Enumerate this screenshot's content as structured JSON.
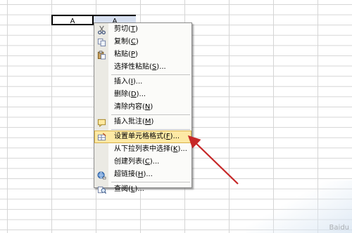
{
  "sheet": {
    "cell_a": "A",
    "cell_b": "A"
  },
  "context_menu": {
    "items": [
      {
        "label": "剪切",
        "key": "T",
        "suffix": "",
        "icon": "scissors-icon"
      },
      {
        "label": "复制",
        "key": "C",
        "suffix": "",
        "icon": "copy-icon"
      },
      {
        "label": "粘贴",
        "key": "P",
        "suffix": "",
        "icon": "paste-icon"
      },
      {
        "label": "选择性粘贴",
        "key": "S",
        "suffix": "...",
        "icon": ""
      },
      {
        "label": "插入",
        "key": "I",
        "suffix": "...",
        "icon": ""
      },
      {
        "label": "删除",
        "key": "D",
        "suffix": "...",
        "icon": ""
      },
      {
        "label": "清除内容",
        "key": "N",
        "suffix": "",
        "icon": ""
      },
      {
        "label": "插入批注",
        "key": "M",
        "suffix": "",
        "icon": "comment-icon"
      },
      {
        "label": "设置单元格格式",
        "key": "F",
        "suffix": "...",
        "icon": "format-cells-icon"
      },
      {
        "label": "从下拉列表中选择",
        "key": "K",
        "suffix": "...",
        "icon": ""
      },
      {
        "label": "创建列表",
        "key": "C",
        "suffix": "...",
        "icon": ""
      },
      {
        "label": "超链接",
        "key": "H",
        "suffix": "...",
        "icon": "hyperlink-icon"
      },
      {
        "label": "查阅",
        "key": "L",
        "suffix": "...",
        "icon": "lookup-icon"
      }
    ],
    "highlighted_index": 8
  },
  "watermark": "Baidu"
}
